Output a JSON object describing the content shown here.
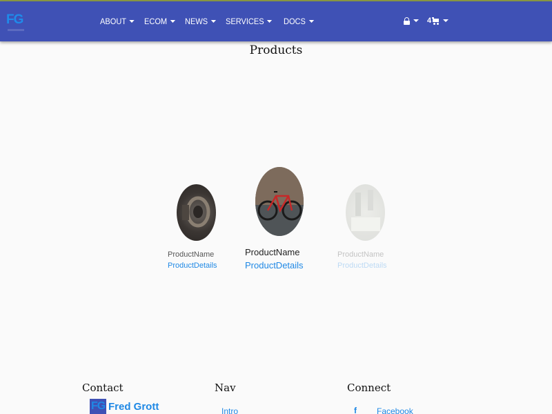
{
  "nav": {
    "logo": "FG",
    "menu": [
      "ABOUT",
      "ECOM",
      "NEWS",
      "SERVICES",
      "DOCS"
    ],
    "cart_count": "4"
  },
  "page_title": "Products",
  "products": [
    {
      "name": "ProductName",
      "details": "ProductDetails"
    },
    {
      "name": "ProductName",
      "details": "ProductDetails"
    },
    {
      "name": "ProductName",
      "details": "ProductDetails"
    }
  ],
  "footer": {
    "contact_title": "Contact",
    "nav_title": "Nav",
    "connect_title": "Connect",
    "brand_mark": "FG",
    "brand_name": "Fred Grott",
    "nav_link": "Intro",
    "facebook_icon": "f",
    "facebook_link": "Facebook"
  },
  "colors": {
    "navbar": "#3f51b5",
    "accent": "#1e88e5"
  },
  "icons": [
    "lock-icon",
    "cart-icon",
    "caret-down-icon",
    "facebook-icon"
  ]
}
